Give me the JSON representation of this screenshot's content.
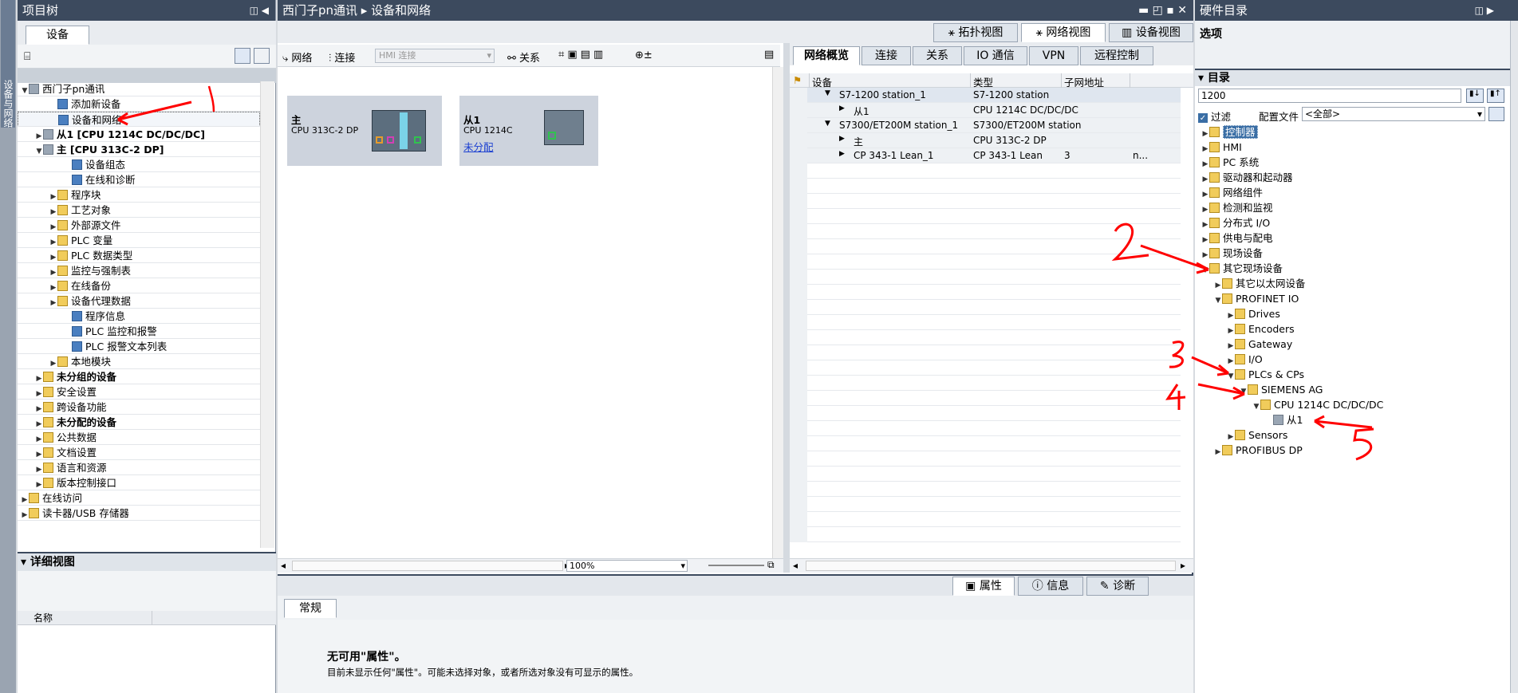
{
  "project_tree": {
    "title": "项目树",
    "tab": "设备",
    "items": [
      {
        "label": "西门子pn通讯",
        "indent": 0,
        "tw": "▼",
        "bold": false,
        "icon": "grey"
      },
      {
        "label": "添加新设备",
        "indent": 2,
        "tw": "",
        "bold": false,
        "icon": "blue"
      },
      {
        "label": "设备和网络",
        "indent": 2,
        "tw": "",
        "bold": false,
        "icon": "blue"
      },
      {
        "label": "从1 [CPU 1214C DC/DC/DC]",
        "indent": 1,
        "tw": "▶",
        "bold": true,
        "icon": "grey"
      },
      {
        "label": "主 [CPU 313C-2 DP]",
        "indent": 1,
        "tw": "▼",
        "bold": true,
        "icon": "grey"
      },
      {
        "label": "设备组态",
        "indent": 3,
        "tw": "",
        "bold": false,
        "icon": "blue"
      },
      {
        "label": "在线和诊断",
        "indent": 3,
        "tw": "",
        "bold": false,
        "icon": "blue"
      },
      {
        "label": "程序块",
        "indent": 2,
        "tw": "▶",
        "bold": false,
        "icon": "fold"
      },
      {
        "label": "工艺对象",
        "indent": 2,
        "tw": "▶",
        "bold": false,
        "icon": "fold"
      },
      {
        "label": "外部源文件",
        "indent": 2,
        "tw": "▶",
        "bold": false,
        "icon": "fold"
      },
      {
        "label": "PLC 变量",
        "indent": 2,
        "tw": "▶",
        "bold": false,
        "icon": "fold"
      },
      {
        "label": "PLC 数据类型",
        "indent": 2,
        "tw": "▶",
        "bold": false,
        "icon": "fold"
      },
      {
        "label": "监控与强制表",
        "indent": 2,
        "tw": "▶",
        "bold": false,
        "icon": "fold"
      },
      {
        "label": "在线备份",
        "indent": 2,
        "tw": "▶",
        "bold": false,
        "icon": "fold"
      },
      {
        "label": "设备代理数据",
        "indent": 2,
        "tw": "▶",
        "bold": false,
        "icon": "fold"
      },
      {
        "label": "程序信息",
        "indent": 3,
        "tw": "",
        "bold": false,
        "icon": "blue"
      },
      {
        "label": "PLC 监控和报警",
        "indent": 3,
        "tw": "",
        "bold": false,
        "icon": "blue"
      },
      {
        "label": "PLC 报警文本列表",
        "indent": 3,
        "tw": "",
        "bold": false,
        "icon": "blue"
      },
      {
        "label": "本地模块",
        "indent": 2,
        "tw": "▶",
        "bold": false,
        "icon": "fold"
      },
      {
        "label": "未分组的设备",
        "indent": 1,
        "tw": "▶",
        "bold": true,
        "icon": "fold"
      },
      {
        "label": "安全设置",
        "indent": 1,
        "tw": "▶",
        "bold": false,
        "icon": "fold"
      },
      {
        "label": "跨设备功能",
        "indent": 1,
        "tw": "▶",
        "bold": false,
        "icon": "fold"
      },
      {
        "label": "未分配的设备",
        "indent": 1,
        "tw": "▶",
        "bold": true,
        "icon": "fold"
      },
      {
        "label": "公共数据",
        "indent": 1,
        "tw": "▶",
        "bold": false,
        "icon": "fold"
      },
      {
        "label": "文档设置",
        "indent": 1,
        "tw": "▶",
        "bold": false,
        "icon": "fold"
      },
      {
        "label": "语言和资源",
        "indent": 1,
        "tw": "▶",
        "bold": false,
        "icon": "fold"
      },
      {
        "label": "版本控制接口",
        "indent": 1,
        "tw": "▶",
        "bold": false,
        "icon": "fold"
      },
      {
        "label": "在线访问",
        "indent": 0,
        "tw": "▶",
        "bold": false,
        "icon": "fold"
      },
      {
        "label": "读卡器/USB 存储器",
        "indent": 0,
        "tw": "▶",
        "bold": false,
        "icon": "fold"
      }
    ],
    "details": "详细视图",
    "col": "名称",
    "side": "设备与网络"
  },
  "editor": {
    "title": "西门子pn通讯 ▸ 设备和网络",
    "view_tabs": [
      "拓扑视图",
      "网络视图",
      "设备视图"
    ],
    "toolbar": {
      "network": "网络",
      "connect": "连接",
      "hmi": "HMI 连接",
      "relation": "关系",
      "zoom": "100%"
    },
    "devices": [
      {
        "name": "主",
        "cpu": "CPU 313C-2 DP",
        "extra": ""
      },
      {
        "name": "从1",
        "cpu": "CPU 1214C",
        "extra": "未分配"
      }
    ],
    "overview_tabs": [
      "网络概览",
      "连接",
      "关系",
      "IO 通信",
      "VPN",
      "远程控制"
    ],
    "columns": [
      "设备",
      "类型",
      "子网地址",
      ""
    ],
    "rows": [
      [
        "S7-1200 station_1",
        "S7-1200 station",
        "",
        ""
      ],
      [
        "从1",
        "CPU 1214C DC/DC/DC",
        "",
        ""
      ],
      [
        "S7300/ET200M station_1",
        "S7300/ET200M station",
        "",
        ""
      ],
      [
        "主",
        "CPU 313C-2 DP",
        "",
        ""
      ],
      [
        "CP 343-1 Lean_1",
        "CP 343-1 Lean",
        "3",
        "n..."
      ]
    ],
    "insp_tabs": [
      "属性",
      "信息",
      "诊断"
    ],
    "gen_tab": "常规",
    "msg_title": "无可用\"属性\"。",
    "msg_text": "目前未显示任何\"属性\"。可能未选择对象，或者所选对象没有可显示的属性。"
  },
  "catalog": {
    "title": "硬件目录",
    "options": "选项",
    "dir": "目录",
    "search": "1200",
    "filter": "过滤",
    "profile_label": "配置文件",
    "profile": "<全部>",
    "items": [
      {
        "label": "控制器",
        "indent": 0,
        "tw": "▶",
        "sel": true
      },
      {
        "label": "HMI",
        "indent": 0,
        "tw": "▶"
      },
      {
        "label": "PC 系统",
        "indent": 0,
        "tw": "▶"
      },
      {
        "label": "驱动器和起动器",
        "indent": 0,
        "tw": "▶"
      },
      {
        "label": "网络组件",
        "indent": 0,
        "tw": "▶"
      },
      {
        "label": "检测和监视",
        "indent": 0,
        "tw": "▶"
      },
      {
        "label": "分布式 I/O",
        "indent": 0,
        "tw": "▶"
      },
      {
        "label": "供电与配电",
        "indent": 0,
        "tw": "▶"
      },
      {
        "label": "现场设备",
        "indent": 0,
        "tw": "▶"
      },
      {
        "label": "其它现场设备",
        "indent": 0,
        "tw": "▼"
      },
      {
        "label": "其它以太网设备",
        "indent": 1,
        "tw": "▶"
      },
      {
        "label": "PROFINET IO",
        "indent": 1,
        "tw": "▼"
      },
      {
        "label": "Drives",
        "indent": 2,
        "tw": "▶"
      },
      {
        "label": "Encoders",
        "indent": 2,
        "tw": "▶"
      },
      {
        "label": "Gateway",
        "indent": 2,
        "tw": "▶"
      },
      {
        "label": "I/O",
        "indent": 2,
        "tw": "▶"
      },
      {
        "label": "PLCs & CPs",
        "indent": 2,
        "tw": "▼"
      },
      {
        "label": "SIEMENS AG",
        "indent": 3,
        "tw": "▼"
      },
      {
        "label": "CPU 1214C DC/DC/DC",
        "indent": 4,
        "tw": "▼"
      },
      {
        "label": "从1",
        "indent": 5,
        "tw": "",
        "dev": true
      },
      {
        "label": "Sensors",
        "indent": 2,
        "tw": "▶"
      },
      {
        "label": "PROFIBUS DP",
        "indent": 1,
        "tw": "▶"
      }
    ]
  },
  "annotations": [
    "1",
    "2",
    "3",
    "4",
    "5"
  ]
}
